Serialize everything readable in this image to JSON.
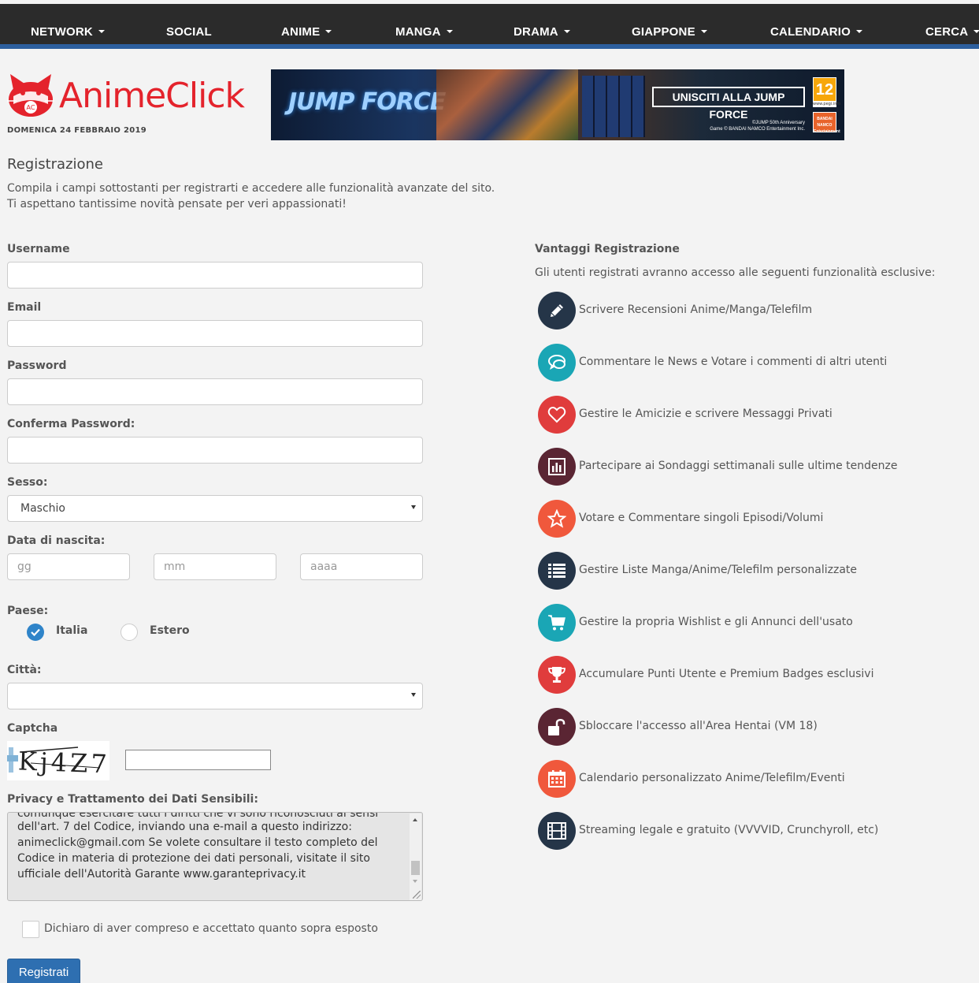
{
  "nav": {
    "items": [
      {
        "label": "NETWORK",
        "dropdown": true
      },
      {
        "label": "SOCIAL",
        "dropdown": false
      },
      {
        "label": "ANIME",
        "dropdown": true
      },
      {
        "label": "MANGA",
        "dropdown": true
      },
      {
        "label": "DRAMA",
        "dropdown": true
      },
      {
        "label": "GIAPPONE",
        "dropdown": true
      },
      {
        "label": "CALENDARIO",
        "dropdown": true
      },
      {
        "label": "CERCA",
        "dropdown": true
      }
    ]
  },
  "header": {
    "logo_text": "AnimeClick",
    "logo_badge": "AC",
    "date": "DOMENICA 24 FEBBRAIO 2019",
    "banner": {
      "title": "JUMP FORCE",
      "cta": "UNISCITI ALLA JUMP FORCE",
      "fine_print_1": "©JUMP 50th Anniversary",
      "fine_print_2": "Game © BANDAI NAMCO Entertainment Inc.",
      "rating": "12",
      "rating_sub": "www.pegi.info",
      "publisher": "BANDAI NAMCO Entertainment"
    }
  },
  "page": {
    "title": "Registrazione",
    "intro_1": "Compila i campi sottostanti per registrarti e accedere alle funzionalità avanzate del sito.",
    "intro_2": "Ti aspettano tantissime novità pensate per veri appassionati!"
  },
  "form": {
    "username_label": "Username",
    "email_label": "Email",
    "password_label": "Password",
    "confirm_password_label": "Conferma Password:",
    "gender_label": "Sesso:",
    "gender_value": "Maschio",
    "birth_label": "Data di nascita:",
    "birth_day_placeholder": "gg",
    "birth_month_placeholder": "mm",
    "birth_year_placeholder": "aaaa",
    "country_label": "Paese:",
    "country_italy": "Italia",
    "country_foreign": "Estero",
    "country_selected": "Italia",
    "city_label": "Città:",
    "city_value": "",
    "captcha_label": "Captcha",
    "captcha_image_text": "Kj4Z7",
    "privacy_label": "Privacy e Trattamento dei Dati Sensibili:",
    "privacy_cut_line": "comunque esercitare tutti i diritti che vi sono riconosciuti ai sensi",
    "privacy_text": "dell'art. 7 del Codice, inviando una e-mail a questo indirizzo: animeclick@gmail.com Se volete consultare il testo completo del Codice in materia di protezione dei dati personali, visitate il sito ufficiale dell'Autorità Garante www.garanteprivacy.it",
    "accept_label": "Dichiaro di aver compreso e accettato quanto sopra esposto",
    "submit_label": "Registrati"
  },
  "benefits": {
    "title": "Vantaggi Registrazione",
    "intro": "Gli utenti registrati avranno accesso alle seguenti funzionalità esclusive:",
    "items": [
      {
        "label": "Scrivere Recensioni Anime/Manga/Telefilm",
        "icon": "pencil-icon",
        "color": "#253548"
      },
      {
        "label": "Commentare le News e Votare i commenti di altri utenti",
        "icon": "chat-icon",
        "color": "#1aa6b5"
      },
      {
        "label": "Gestire le Amicizie e scrivere Messaggi Privati",
        "icon": "heart-icon",
        "color": "#e03c3c"
      },
      {
        "label": "Partecipare ai Sondaggi settimanali sulle ultime tendenze",
        "icon": "bar-chart-icon",
        "color": "#5a2533"
      },
      {
        "label": "Votare e Commentare singoli Episodi/Volumi",
        "icon": "star-icon",
        "color": "#f0583c"
      },
      {
        "label": "Gestire Liste Manga/Anime/Telefilm personalizzate",
        "icon": "list-icon",
        "color": "#253548"
      },
      {
        "label": "Gestire la propria Wishlist e gli Annunci dell'usato",
        "icon": "cart-icon",
        "color": "#1aa6b5"
      },
      {
        "label": "Accumulare Punti Utente e Premium Badges esclusivi",
        "icon": "trophy-icon",
        "color": "#e03c3c"
      },
      {
        "label": "Sbloccare l'accesso all'Area Hentai (VM 18)",
        "icon": "unlock-icon",
        "color": "#5a2533"
      },
      {
        "label": "Calendario personalizzato Anime/Telefilm/Eventi",
        "icon": "calendar-icon",
        "color": "#f0583c"
      },
      {
        "label": "Streaming legale e gratuito (VVVVID, Crunchyroll, etc)",
        "icon": "film-icon",
        "color": "#253548"
      }
    ]
  },
  "colors": {
    "nav_bg": "#2b2b2b",
    "nav_accent": "#2d5f9e",
    "brand_red": "#e4232c",
    "button_blue": "#2e6fb1",
    "radio_blue": "#2f84c9"
  }
}
